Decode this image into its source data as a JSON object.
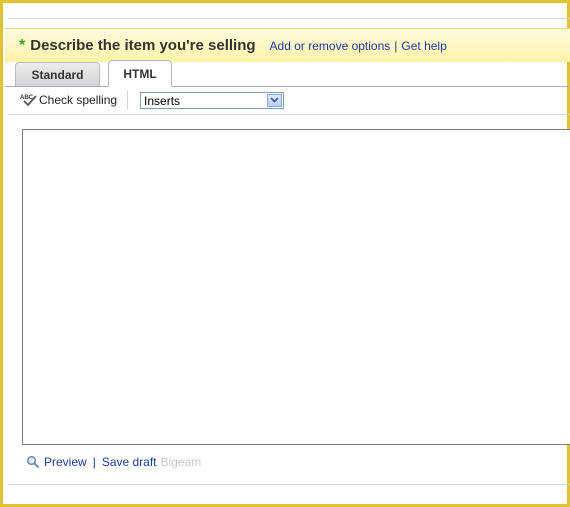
{
  "section": {
    "required_mark": "*",
    "title": "Describe the item you're selling",
    "link_options": "Add or remove options",
    "link_separator": "|",
    "link_help": "Get help"
  },
  "tabs": [
    {
      "label": "Standard",
      "active": false
    },
    {
      "label": "HTML",
      "active": true
    }
  ],
  "toolbar": {
    "spell_label": "Check spelling",
    "inserts_selected": "Inserts"
  },
  "editor": {
    "value": ""
  },
  "footer": {
    "preview_label": "Preview",
    "separator": "|",
    "save_label": "Save draft",
    "faded_label": "Bigeam"
  },
  "colors": {
    "frame": "#e2c230",
    "header_bg": "#fff3a8",
    "required_star": "#2ea71f",
    "link": "#1a3ba0"
  },
  "icons": {
    "spell": "spell-check-icon",
    "dropdown": "chevron-down-icon",
    "preview": "magnifier-icon"
  }
}
